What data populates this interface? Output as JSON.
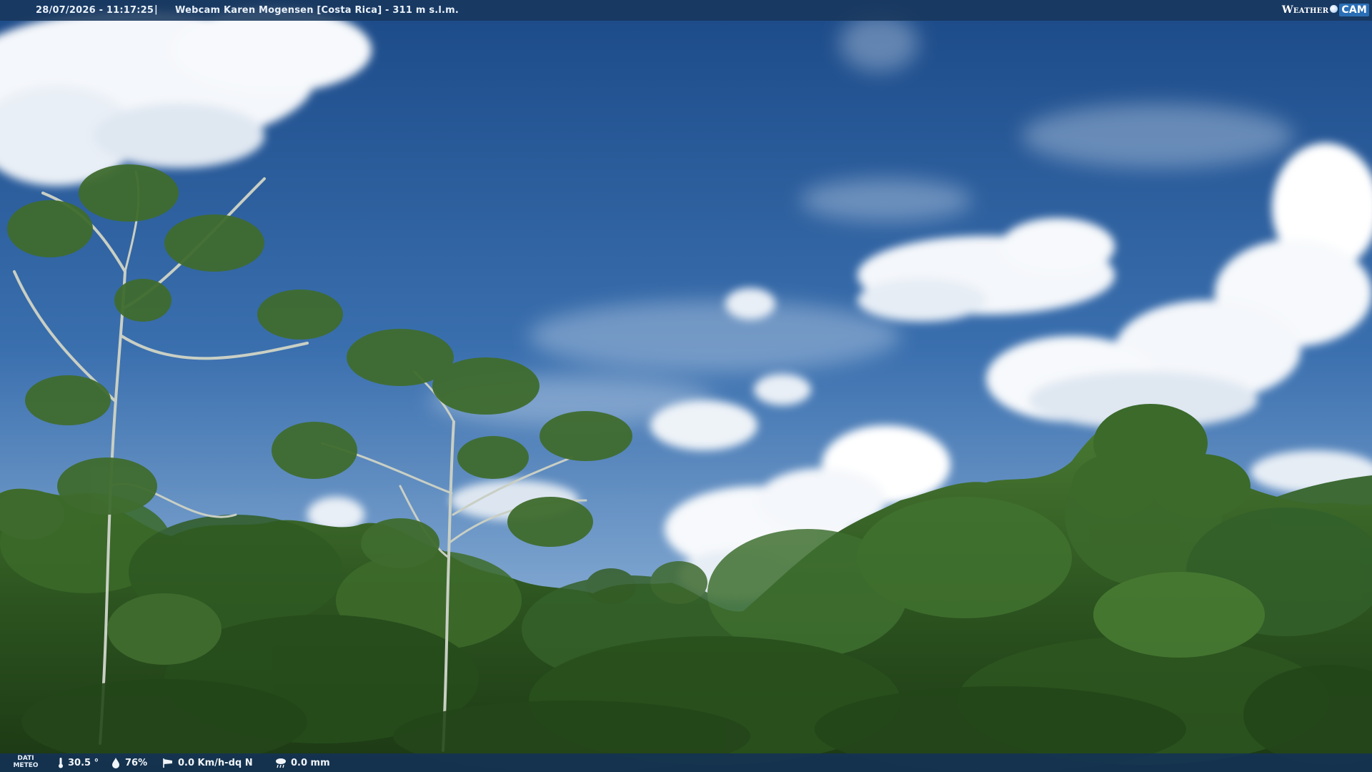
{
  "overlay": {
    "timestamp": "28/07/2026 - 11:17:25",
    "separator": "|",
    "title": "Webcam Karen Mogensen [Costa Rica]  - 311 m s.l.m."
  },
  "logo": {
    "weather": "Weather",
    "cam": "CAM"
  },
  "meteo": {
    "label_line1": "DATI",
    "label_line2": "METEO",
    "temperature": "30.5 °",
    "humidity": "76%",
    "wind": "0.0 Km/h-dq N",
    "rain": "0.0 mm"
  },
  "icons": {
    "temperature": "thermometer-icon",
    "humidity": "humidity-drop-icon",
    "wind": "wind-sock-icon",
    "rain": "rain-cloud-icon"
  },
  "colors": {
    "sky_top": "#1e4e8c",
    "sky_bottom": "#7fa6cf",
    "foliage": "#2f5a1f",
    "overlay_bar": "#18375c"
  }
}
